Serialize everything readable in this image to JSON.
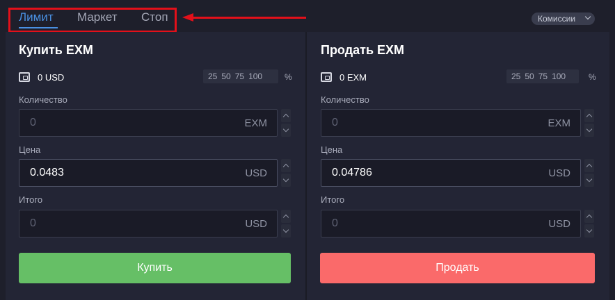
{
  "tabs": [
    {
      "label": "Лимит",
      "active": true
    },
    {
      "label": "Маркет",
      "active": false
    },
    {
      "label": "Стоп",
      "active": false
    }
  ],
  "fees": {
    "label": "Комиссии",
    "icon": "chevron-down-icon"
  },
  "annotation": {
    "color": "#e3101a"
  },
  "buy": {
    "title": "Купить EXM",
    "balance": "0 USD",
    "percents": [
      "25",
      "50",
      "75",
      "100"
    ],
    "percent_sign": "%",
    "quantity": {
      "label": "Количество",
      "placeholder": "0",
      "unit": "EXM"
    },
    "price": {
      "label": "Цена",
      "value": "0.0483",
      "unit": "USD"
    },
    "total": {
      "label": "Итого",
      "placeholder": "0",
      "unit": "USD"
    },
    "button": {
      "label": "Купить",
      "color": "#66bf66"
    }
  },
  "sell": {
    "title": "Продать EXM",
    "balance": "0 EXM",
    "percents": [
      "25",
      "50",
      "75",
      "100"
    ],
    "percent_sign": "%",
    "quantity": {
      "label": "Количество",
      "placeholder": "0",
      "unit": "EXM"
    },
    "price": {
      "label": "Цена",
      "value": "0.04786",
      "unit": "USD"
    },
    "total": {
      "label": "Итого",
      "placeholder": "0",
      "unit": "USD"
    },
    "button": {
      "label": "Продать",
      "color": "#fa6a6a"
    }
  },
  "colors": {
    "accent": "#4a90e2",
    "background": "#1e1f2b",
    "panel": "#232535"
  }
}
